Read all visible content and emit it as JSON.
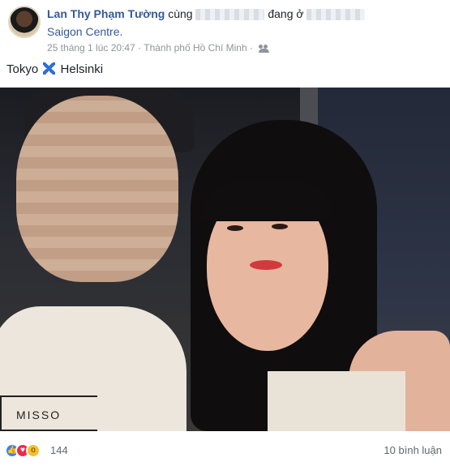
{
  "post": {
    "author": "Lan Thy Phạm Tường",
    "with_word": "cùng",
    "at_word": "đang ở",
    "place": "Saigon Centre.",
    "timestamp": "25 tháng 1 lúc 20:47",
    "separator": "·",
    "location": "Thành phố Hồ Chí Minh",
    "privacy_icon": "friends-icon",
    "text_before": "Tokyo",
    "text_emoji": "cross-mark-emoji",
    "text_after": "Helsinki"
  },
  "footer": {
    "reactions": [
      "like",
      "love",
      "wow"
    ],
    "reaction_count": "144",
    "comments": "10 bình luận"
  },
  "colors": {
    "link": "#365899",
    "muted": "#90949c",
    "like": "#3b82f0",
    "love": "#f0284a",
    "wow": "#f7c02b"
  }
}
